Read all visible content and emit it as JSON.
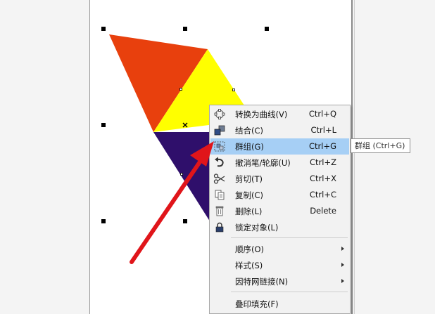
{
  "context_menu": {
    "items": [
      {
        "label": "转换为曲线(V)",
        "shortcut": "Ctrl+Q",
        "icon": "curve-node-icon"
      },
      {
        "label": "结合(C)",
        "shortcut": "Ctrl+L",
        "icon": "combine-icon"
      },
      {
        "label": "群组(G)",
        "shortcut": "Ctrl+G",
        "icon": "group-icon",
        "highlighted": true
      },
      {
        "label": "撤消笔/轮廓(U)",
        "shortcut": "Ctrl+Z",
        "icon": "undo-icon"
      },
      {
        "label": "剪切(T)",
        "shortcut": "Ctrl+X",
        "icon": "scissors-icon"
      },
      {
        "label": "复制(C)",
        "shortcut": "Ctrl+C",
        "icon": "copy-icon"
      },
      {
        "label": "删除(L)",
        "shortcut": "Delete",
        "icon": "trash-icon"
      },
      {
        "label": "锁定对象(L)",
        "shortcut": "",
        "icon": "lock-icon"
      },
      {
        "label": "顺序(O)",
        "submenu": true
      },
      {
        "label": "样式(S)",
        "submenu": true
      },
      {
        "label": "因特网链接(N)",
        "submenu": true
      },
      {
        "label": "叠印填充(F)",
        "shortcut": ""
      }
    ]
  },
  "tooltip": {
    "text": "群组 (Ctrl+G)"
  },
  "colors": {
    "orange_triangle": "#e8400d",
    "yellow_triangle": "#ffff00",
    "purple_triangle": "#2f0f6b",
    "menu_highlight": "#a6cff5",
    "annotation_arrow": "#e0151a"
  }
}
